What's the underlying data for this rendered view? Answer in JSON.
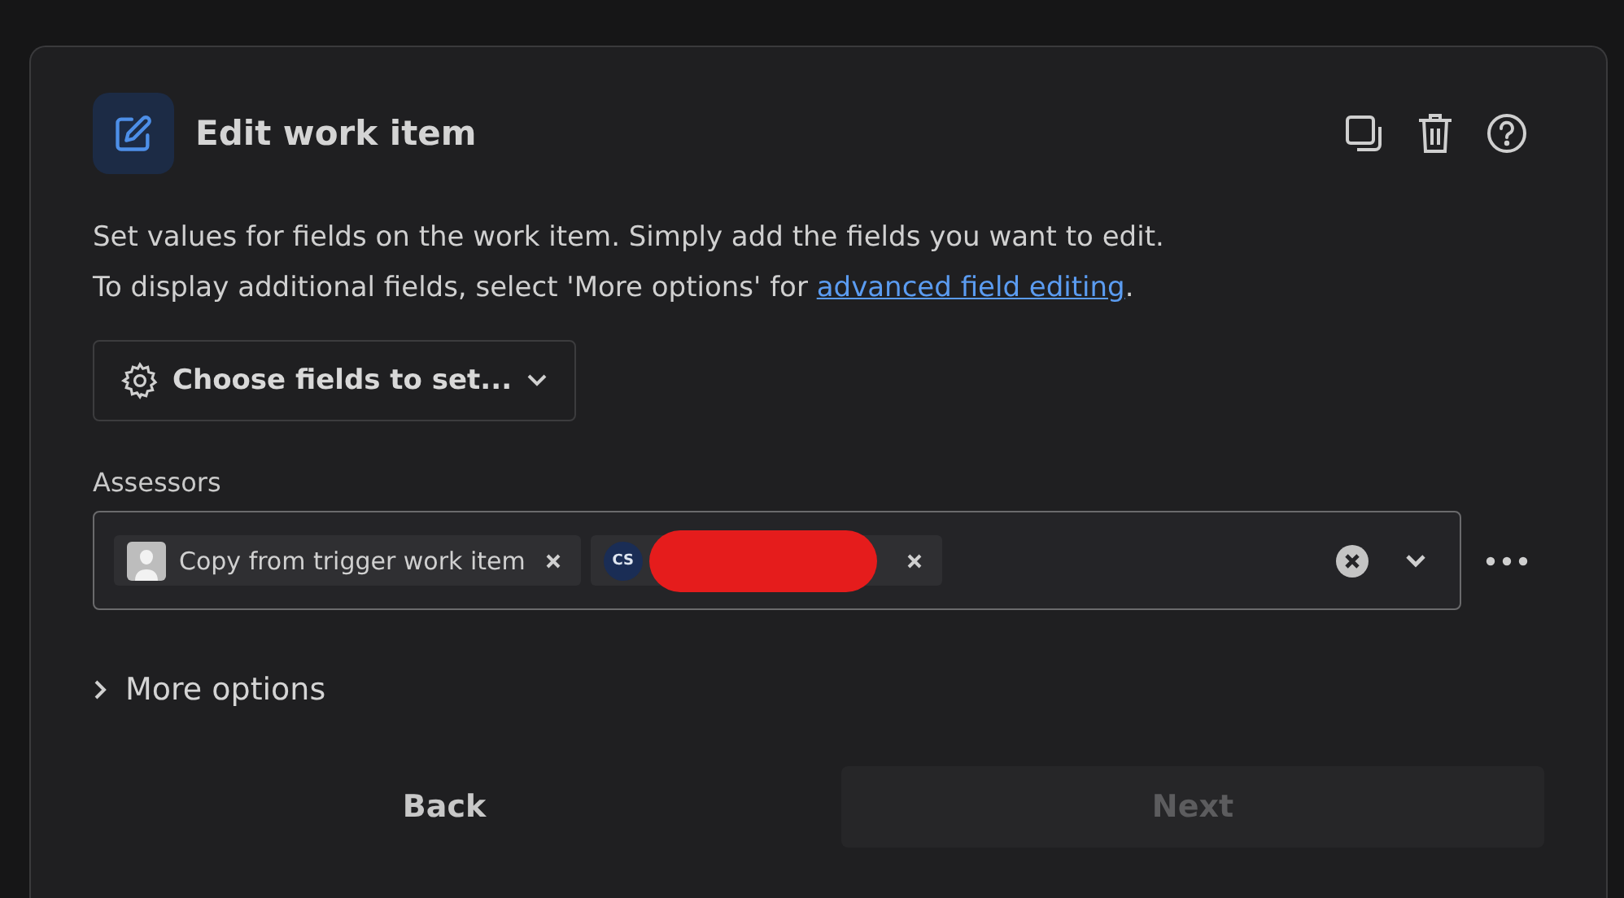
{
  "header": {
    "title": "Edit work item"
  },
  "description": {
    "line_1": "Set values for fields on the work item. Simply add the fields you want to edit.",
    "line_2": "To display additional fields, select 'More options' for ",
    "link": "advanced field editing",
    "line_2_end": "."
  },
  "choose_fields": {
    "label": "Choose fields to set..."
  },
  "field": {
    "label": "Assessors",
    "chips": [
      {
        "kind": "placeholder-avatar",
        "label": "Copy from trigger work item",
        "redacted": false
      },
      {
        "kind": "initials",
        "initials": "CS",
        "redacted": true
      }
    ]
  },
  "more_options": {
    "label": "More options",
    "expanded": false
  },
  "buttons": [
    {
      "label": "Back",
      "disabled": false
    },
    {
      "label": "Next",
      "disabled": true
    }
  ]
}
